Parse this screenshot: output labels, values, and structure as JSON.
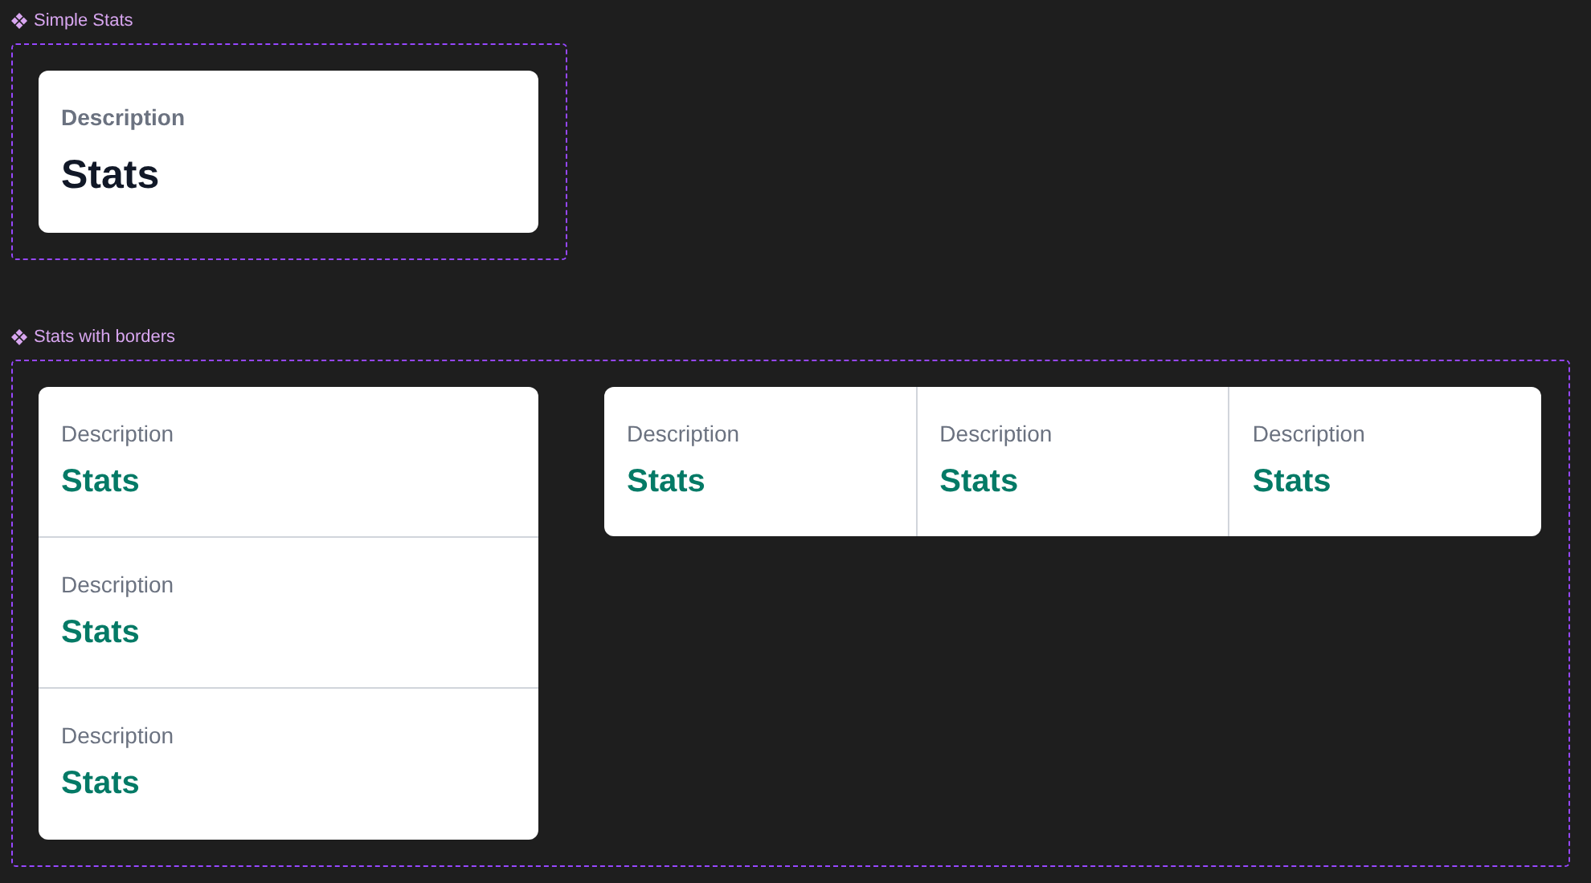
{
  "sections": [
    {
      "title": "Simple Stats",
      "groups": [
        {
          "kind": "simple",
          "items": [
            {
              "description": "Description",
              "value": "Stats"
            }
          ]
        }
      ]
    },
    {
      "title": "Stats with borders",
      "groups": [
        {
          "kind": "vertical",
          "items": [
            {
              "description": "Description",
              "value": "Stats"
            },
            {
              "description": "Description",
              "value": "Stats"
            },
            {
              "description": "Description",
              "value": "Stats"
            }
          ]
        },
        {
          "kind": "horizontal",
          "items": [
            {
              "description": "Description",
              "value": "Stats"
            },
            {
              "description": "Description",
              "value": "Stats"
            },
            {
              "description": "Description",
              "value": "Stats"
            }
          ]
        }
      ]
    }
  ]
}
